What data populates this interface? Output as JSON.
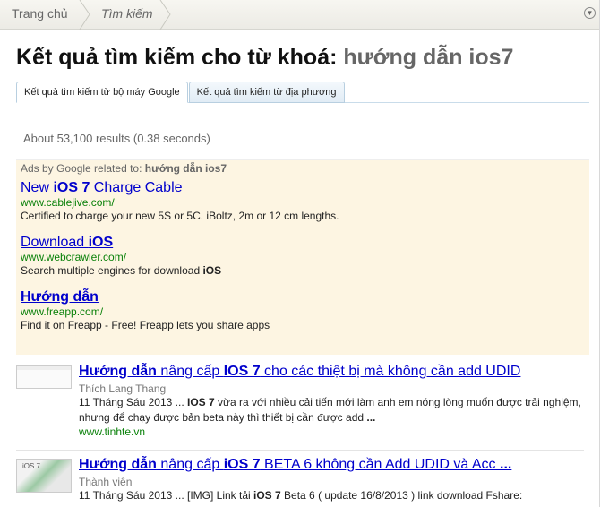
{
  "breadcrumb": [
    "Trang chủ",
    "Tìm kiếm"
  ],
  "title": {
    "prefix": "Kết quả tìm kiếm cho từ khoá:",
    "keyword": "hướng dẫn ios7"
  },
  "tabs": [
    "Kết quả tìm kiếm từ bộ máy Google",
    "Kết quả tìm kiếm từ địa phương"
  ],
  "result_count": "About 53,100 results (0.38 seconds)",
  "ads": {
    "header": "Ads by Google related to:",
    "keyword": "hướng dẫn ios7",
    "items": [
      {
        "t1": "New ",
        "t2": "iOS 7",
        "t3": " Charge Cable",
        "url": "www.cablejive.com/",
        "desc": "Certified to charge your new 5S or 5C. iBoltz, 2m or 12 cm lengths.",
        "d2": ""
      },
      {
        "t1": "Download ",
        "t2": "iOS",
        "t3": "",
        "url": "www.webcrawler.com/",
        "desc": "Search multiple engines for download ",
        "d2": "iOS"
      },
      {
        "t1": "",
        "t2": "Hướng dẫn",
        "t3": "",
        "url": "www.freapp.com/",
        "desc": "Find it on Freapp - Free! Freapp lets you share apps",
        "d2": ""
      }
    ]
  },
  "results": [
    {
      "b1": "Hướng dẫn",
      "m1": " nâng cấp ",
      "b2": "IOS 7",
      "m2": " cho các thiệt bị mà không cần add UDID",
      "author": "Thích Lang Thang",
      "date": "11 Tháng Sáu 2013 ... ",
      "db": "IOS 7",
      "desc": " vừa ra với nhiều cải tiến mới làm anh em nóng lòng muốn được trải nghiệm, nhưng để chạy được bản beta này thì thiết bị cần được add ",
      "end": "...",
      "url": "www.tinhte.vn"
    },
    {
      "b1": "Hướng dẫn",
      "m1": " nâng cấp ",
      "b2": "iOS 7",
      "m2": " BETA 6 không cần Add UDID và Acc ",
      "end_title": "...",
      "author": "Thành viên",
      "date": "11 Tháng Sáu 2013 ... [IMG] Link tải ",
      "db": "iOS 7",
      "desc": " Beta 6 ( update 16/8/2013 ) link download Fshare:",
      "thumb_label": "iOS 7"
    }
  ]
}
